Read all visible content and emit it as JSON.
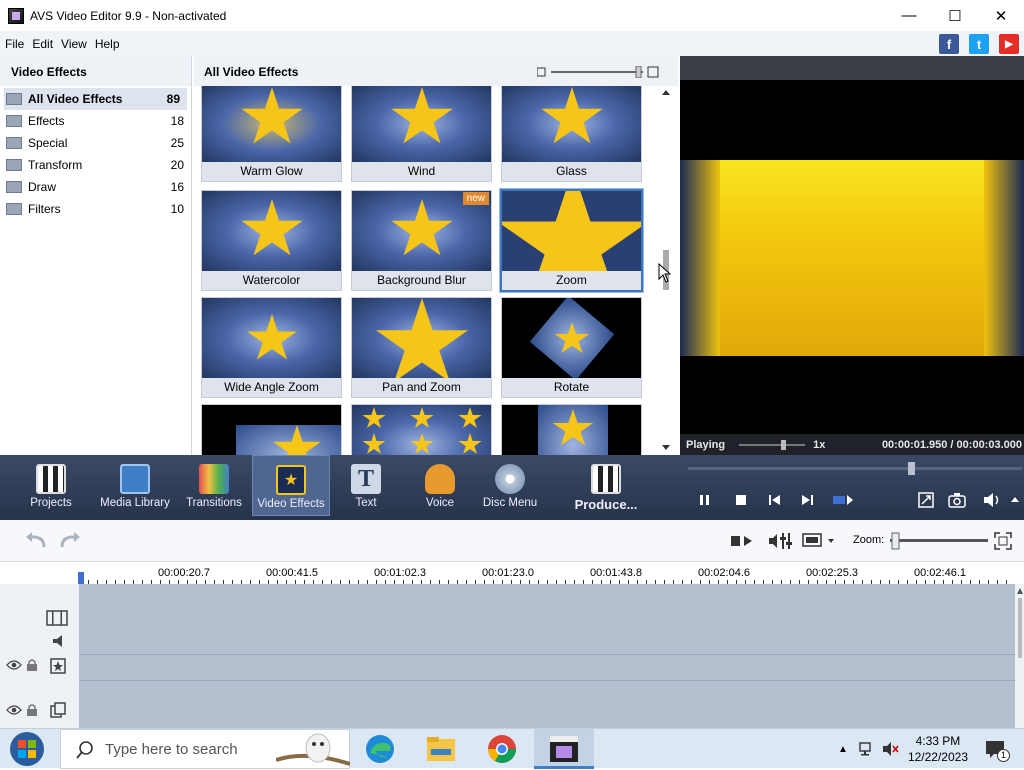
{
  "window": {
    "title": "AVS Video Editor 9.9 - Non-activated",
    "min": "—",
    "max": "☐",
    "close": "✕"
  },
  "menu": [
    "File",
    "Edit",
    "View",
    "Help"
  ],
  "social": {
    "fb": "f",
    "tw": "t",
    "yt": "▶"
  },
  "left_panel": {
    "title": "Video Effects",
    "items": [
      {
        "label": "All Video Effects",
        "count": "89"
      },
      {
        "label": "Effects",
        "count": "18"
      },
      {
        "label": "Special",
        "count": "25"
      },
      {
        "label": "Transform",
        "count": "20"
      },
      {
        "label": "Draw",
        "count": "16"
      },
      {
        "label": "Filters",
        "count": "10"
      }
    ]
  },
  "grid": {
    "title": "All Video Effects",
    "badge_new": "new",
    "tiles": [
      {
        "label": "Warm Glow"
      },
      {
        "label": "Wind"
      },
      {
        "label": "Glass"
      },
      {
        "label": "Watercolor"
      },
      {
        "label": "Background Blur"
      },
      {
        "label": "Zoom"
      },
      {
        "label": "Wide Angle Zoom"
      },
      {
        "label": "Pan and Zoom"
      },
      {
        "label": "Rotate"
      },
      {
        "label": ""
      },
      {
        "label": ""
      },
      {
        "label": ""
      }
    ]
  },
  "preview": {
    "status": "Playing",
    "speed": "1x",
    "time": "00:00:01.950 / 00:00:03.000"
  },
  "toolbar": [
    {
      "label": "Projects"
    },
    {
      "label": "Media Library"
    },
    {
      "label": "Transitions"
    },
    {
      "label": "Video Effects"
    },
    {
      "label": "Text"
    },
    {
      "label": "Voice"
    },
    {
      "label": "Disc Menu"
    },
    {
      "label": "Produce..."
    }
  ],
  "timeline": {
    "zoom_label": "Zoom:",
    "ticks": [
      "00:00:20.7",
      "00:00:41.5",
      "00:01:02.3",
      "00:01:23.0",
      "00:01:43.8",
      "00:02:04.6",
      "00:02:25.3",
      "00:02:46.1"
    ]
  },
  "taskbar": {
    "search_placeholder": "Type here to search",
    "time": "4:33 PM",
    "date": "12/22/2023",
    "notif_count": "1"
  },
  "colors": {
    "toolbar_bg": "#2e3c55",
    "selected": "#4f6690",
    "star": "#f5c518"
  }
}
